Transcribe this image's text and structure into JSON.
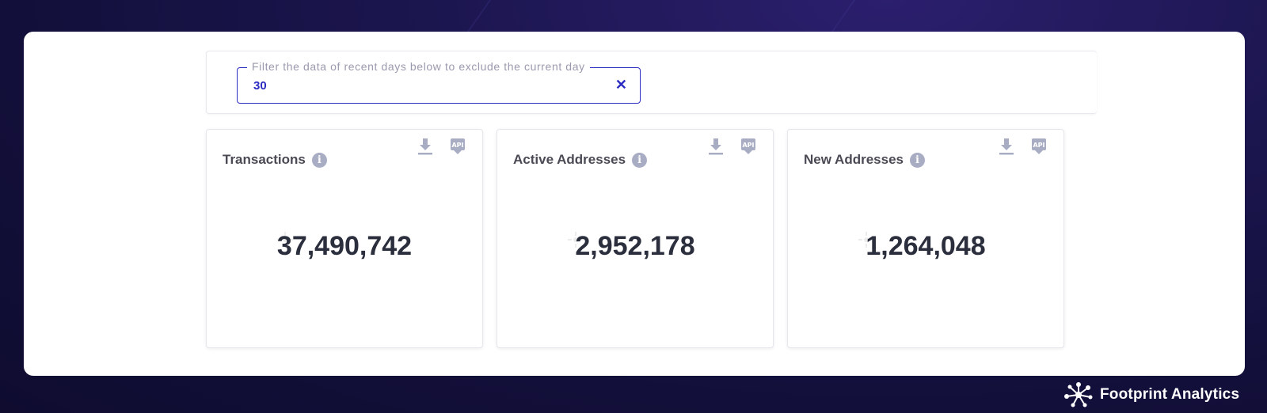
{
  "filter": {
    "legend": "Filter the data of recent days below to exclude the current day",
    "value": "30"
  },
  "cards": [
    {
      "title": "Transactions",
      "value": "37,490,742"
    },
    {
      "title": "Active Addresses",
      "value": "2,952,178"
    },
    {
      "title": "New Addresses",
      "value": "1,264,048"
    }
  ],
  "icons": {
    "info": "info-icon",
    "download": "download-icon",
    "api": "api-icon",
    "clear": "close-icon"
  },
  "api_badge_text": "API",
  "brand": {
    "name": "Footprint Analytics"
  },
  "colors": {
    "accent": "#2d2cc2",
    "background": "#1c1650",
    "icon_gray": "#a9adc4"
  }
}
